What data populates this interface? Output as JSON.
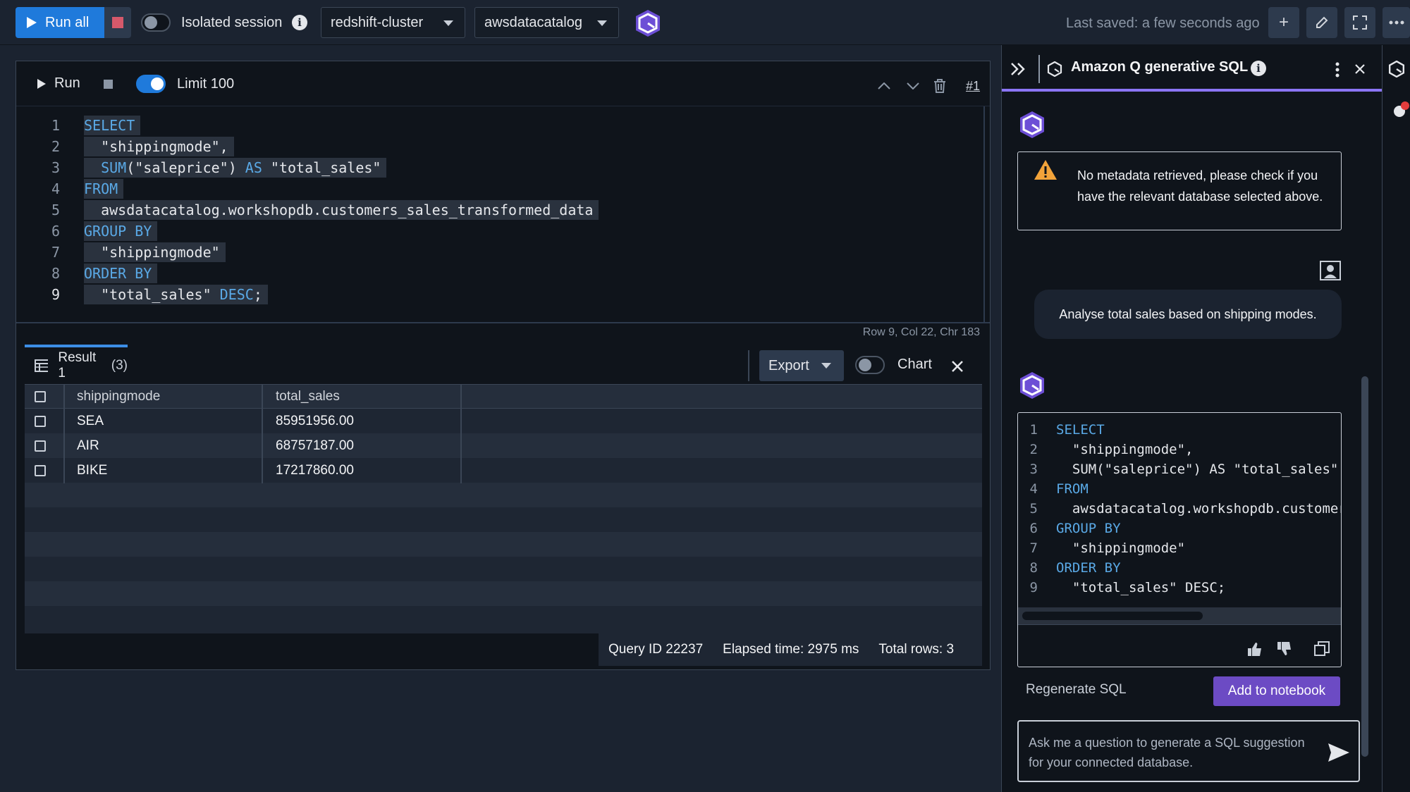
{
  "toolbar": {
    "run_all_label": "Run all",
    "isolated_session_label": "Isolated session",
    "cluster_select": "redshift-cluster",
    "database_select": "awsdatacatalog",
    "last_saved": "Last saved: a few seconds ago",
    "add_icon": "+",
    "edit_icon": "pencil-icon",
    "fullscreen_icon": "fullscreen-icon",
    "more_icon": "ellipsis-icon"
  },
  "editor": {
    "run_label": "Run",
    "limit_label": "Limit 100",
    "cell_number": "#1",
    "line_numbers": [
      "1",
      "2",
      "3",
      "4",
      "5",
      "6",
      "7",
      "8",
      "9"
    ],
    "lines": [
      {
        "kw": "SELECT",
        "rest": ""
      },
      {
        "kw": "",
        "rest": "  \"shippingmode\","
      },
      {
        "kw": "",
        "fn": "  SUM",
        "rest": "(\"saleprice\") ",
        "kw2": "AS",
        "rest2": " \"total_sales\""
      },
      {
        "kw": "FROM",
        "rest": ""
      },
      {
        "kw": "",
        "rest": "  awsdatacatalog.workshopdb.customers_sales_transformed_data"
      },
      {
        "kw": "GROUP BY",
        "rest": ""
      },
      {
        "kw": "",
        "rest": "  \"shippingmode\""
      },
      {
        "kw": "ORDER BY",
        "rest": ""
      },
      {
        "kw": "",
        "rest": "  \"total_sales\" ",
        "kw2": "DESC",
        "rest2": ";"
      }
    ],
    "status": "Row 9,  Col 22,  Chr 183"
  },
  "results": {
    "tab_label": "Result 1",
    "tab_count": "(3)",
    "export_label": "Export",
    "chart_label": "Chart",
    "columns": [
      "shippingmode",
      "total_sales"
    ],
    "rows": [
      [
        "SEA",
        "85951956.00"
      ],
      [
        "AIR",
        "68757187.00"
      ],
      [
        "BIKE",
        "17217860.00"
      ]
    ],
    "query_id": "Query ID 22237",
    "elapsed": "Elapsed time: 2975 ms",
    "total_rows": "Total rows: 3"
  },
  "q_panel": {
    "title": "Amazon Q generative SQL",
    "warning": "No metadata retrieved, please check if you have the relevant database selected above.",
    "user_prompt": "Analyse total sales based on shipping modes.",
    "code_lines": [
      "SELECT",
      "  \"shippingmode\",",
      "  SUM(\"saleprice\") AS \"total_sales\"",
      "FROM",
      "  awsdatacatalog.workshopdb.customers_sales_transformed_data",
      "GROUP BY",
      "  \"shippingmode\"",
      "ORDER BY",
      "  \"total_sales\" DESC;"
    ],
    "regenerate_label": "Regenerate SQL",
    "add_to_notebook_label": "Add to notebook",
    "ask_placeholder": "Ask me a question to generate a SQL suggestion for your connected database."
  },
  "colors": {
    "accent_blue": "#1f7adb",
    "q_purple": "#6c4bc4",
    "keyword": "#5aa9e6"
  }
}
